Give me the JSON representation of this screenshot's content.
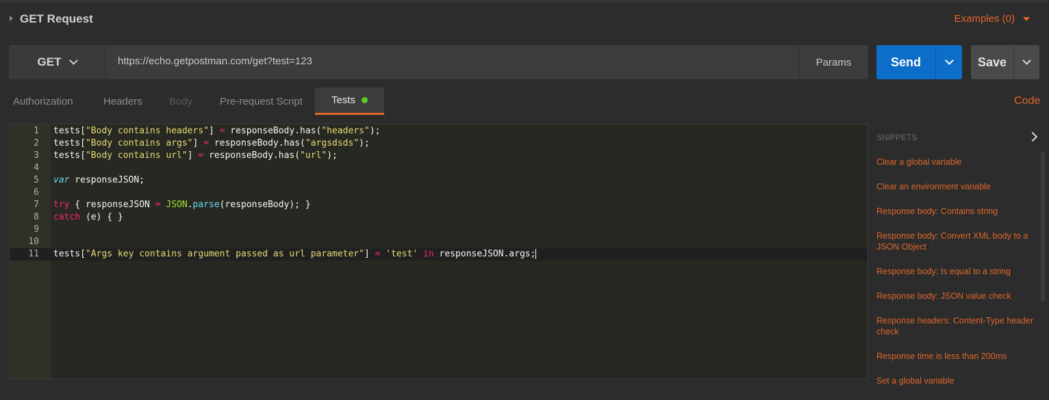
{
  "header": {
    "title": "GET Request",
    "examples_label": "Examples (0)"
  },
  "request": {
    "method": "GET",
    "url": "https://echo.getpostman.com/get?test=123",
    "params_label": "Params",
    "send_label": "Send",
    "save_label": "Save"
  },
  "tabs": [
    {
      "label": "Authorization"
    },
    {
      "label": "Headers"
    },
    {
      "label": "Body"
    },
    {
      "label": "Pre-request Script"
    },
    {
      "label": "Tests"
    }
  ],
  "code_link": "Code",
  "editor": {
    "lines": [
      {
        "n": "1",
        "text": "tests[\"Body contains headers\"] = responseBody.has(\"headers\");"
      },
      {
        "n": "2",
        "text": "tests[\"Body contains args\"] = responseBody.has(\"argsdsds\");"
      },
      {
        "n": "3",
        "text": "tests[\"Body contains url\"] = responseBody.has(\"url\");"
      },
      {
        "n": "4",
        "text": ""
      },
      {
        "n": "5",
        "text": "var responseJSON;"
      },
      {
        "n": "6",
        "text": ""
      },
      {
        "n": "7",
        "text": "try { responseJSON = JSON.parse(responseBody); }"
      },
      {
        "n": "8",
        "text": "catch (e) { }"
      },
      {
        "n": "9",
        "text": ""
      },
      {
        "n": "10",
        "text": ""
      },
      {
        "n": "11",
        "text": "tests[\"Args key contains argument passed as url parameter\"] = 'test' in responseJSON.args;"
      }
    ]
  },
  "snippets": {
    "title": "SNIPPETS",
    "items": [
      "Clear a global variable",
      "Clear an environment variable",
      "Response body: Contains string",
      "Response body: Convert XML body to a JSON Object",
      "Response body: Is equal to a string",
      "Response body: JSON value check",
      "Response headers: Content-Type header check",
      "Response time is less than 200ms",
      "Set a global variable"
    ]
  },
  "colors": {
    "accent": "#e0672a",
    "send_blue": "#0c6ec8",
    "status_green": "#5fc926"
  }
}
